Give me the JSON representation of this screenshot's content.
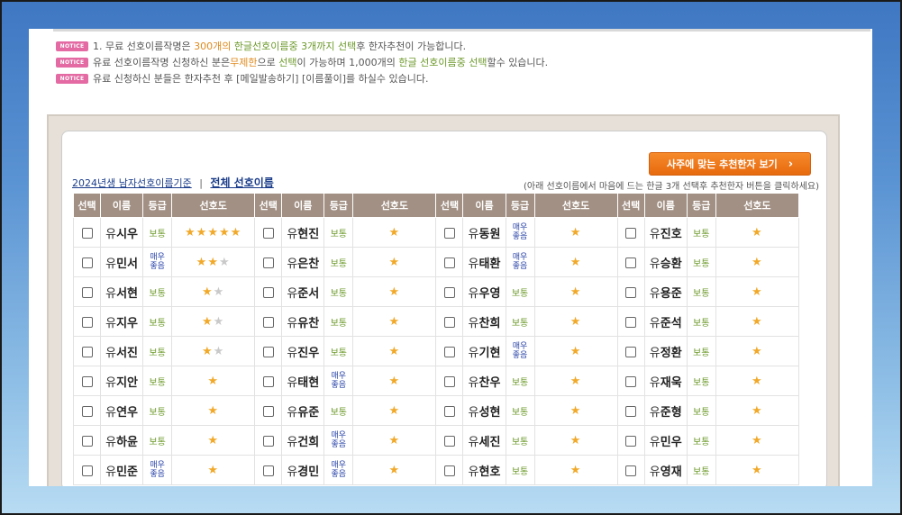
{
  "notices": [
    {
      "badge": "NOTICE",
      "parts": [
        {
          "t": "1. 무료 선호이름작명은 ",
          "c": ""
        },
        {
          "t": "300개의 ",
          "c": "orange"
        },
        {
          "t": "한글선호이름중 3개까지 ",
          "c": "green"
        },
        {
          "t": "선택",
          "c": "green"
        },
        {
          "t": "후 한자추천이 가능합니다.",
          "c": ""
        }
      ]
    },
    {
      "badge": "NOTICE",
      "parts": [
        {
          "t": "유료 선호이름작명 신청하신 분은",
          "c": ""
        },
        {
          "t": "무제한",
          "c": "orange"
        },
        {
          "t": "으로 ",
          "c": ""
        },
        {
          "t": "선택",
          "c": "green"
        },
        {
          "t": "이 가능하며 1,000개의 ",
          "c": ""
        },
        {
          "t": "한글 선호이름중 선택",
          "c": "green"
        },
        {
          "t": "할수 있습니다.",
          "c": ""
        }
      ]
    },
    {
      "badge": "NOTICE",
      "parts": [
        {
          "t": "유료 신청하신 분들은 한자추천 후 [메일발송하기] [이름풀이]를 하실수 있습니다.",
          "c": ""
        }
      ]
    }
  ],
  "links": {
    "criteria": "2024년생 남자선호이름기준",
    "separator": "|",
    "all": "전체 선호이름"
  },
  "recommend_button": "사주에 맞는 추천한자 보기",
  "hint": "(아래 선호이름에서 마음에 드는 한글 3개 선택후 추천한자 버튼을 클릭하세요)",
  "headers": [
    "선택",
    "이름",
    "등급",
    "선호도"
  ],
  "grades": {
    "normal": "보통",
    "good_line1": "매우",
    "good_line2": "좋음"
  },
  "columns": [
    [
      {
        "sur": "유",
        "given": "시우",
        "grade": "normal",
        "stars": 5
      },
      {
        "sur": "유",
        "given": "민서",
        "grade": "good",
        "stars": 2.5
      },
      {
        "sur": "유",
        "given": "서현",
        "grade": "normal",
        "stars": 1.5
      },
      {
        "sur": "유",
        "given": "지우",
        "grade": "normal",
        "stars": 1.5
      },
      {
        "sur": "유",
        "given": "서진",
        "grade": "normal",
        "stars": 1.5
      },
      {
        "sur": "유",
        "given": "지안",
        "grade": "normal",
        "stars": 1
      },
      {
        "sur": "유",
        "given": "연우",
        "grade": "normal",
        "stars": 1
      },
      {
        "sur": "유",
        "given": "하윤",
        "grade": "normal",
        "stars": 1
      },
      {
        "sur": "유",
        "given": "민준",
        "grade": "good",
        "stars": 1
      }
    ],
    [
      {
        "sur": "유",
        "given": "현진",
        "grade": "normal",
        "stars": 1
      },
      {
        "sur": "유",
        "given": "은찬",
        "grade": "normal",
        "stars": 1
      },
      {
        "sur": "유",
        "given": "준서",
        "grade": "normal",
        "stars": 1
      },
      {
        "sur": "유",
        "given": "유찬",
        "grade": "normal",
        "stars": 1
      },
      {
        "sur": "유",
        "given": "진우",
        "grade": "normal",
        "stars": 1
      },
      {
        "sur": "유",
        "given": "태현",
        "grade": "good",
        "stars": 1
      },
      {
        "sur": "유",
        "given": "유준",
        "grade": "normal",
        "stars": 1
      },
      {
        "sur": "유",
        "given": "건희",
        "grade": "good",
        "stars": 1
      },
      {
        "sur": "유",
        "given": "경민",
        "grade": "good",
        "stars": 1
      }
    ],
    [
      {
        "sur": "유",
        "given": "동원",
        "grade": "good",
        "stars": 1
      },
      {
        "sur": "유",
        "given": "태환",
        "grade": "good",
        "stars": 1
      },
      {
        "sur": "유",
        "given": "우영",
        "grade": "normal",
        "stars": 1
      },
      {
        "sur": "유",
        "given": "찬희",
        "grade": "normal",
        "stars": 1
      },
      {
        "sur": "유",
        "given": "기현",
        "grade": "good",
        "stars": 1
      },
      {
        "sur": "유",
        "given": "찬우",
        "grade": "normal",
        "stars": 1
      },
      {
        "sur": "유",
        "given": "성현",
        "grade": "normal",
        "stars": 1
      },
      {
        "sur": "유",
        "given": "세진",
        "grade": "normal",
        "stars": 1
      },
      {
        "sur": "유",
        "given": "현호",
        "grade": "normal",
        "stars": 1
      }
    ],
    [
      {
        "sur": "유",
        "given": "진호",
        "grade": "normal",
        "stars": 1
      },
      {
        "sur": "유",
        "given": "승환",
        "grade": "normal",
        "stars": 1
      },
      {
        "sur": "유",
        "given": "용준",
        "grade": "normal",
        "stars": 1
      },
      {
        "sur": "유",
        "given": "준석",
        "grade": "normal",
        "stars": 1
      },
      {
        "sur": "유",
        "given": "정환",
        "grade": "normal",
        "stars": 1
      },
      {
        "sur": "유",
        "given": "재욱",
        "grade": "normal",
        "stars": 1
      },
      {
        "sur": "유",
        "given": "준형",
        "grade": "normal",
        "stars": 1
      },
      {
        "sur": "유",
        "given": "민우",
        "grade": "normal",
        "stars": 1
      },
      {
        "sur": "유",
        "given": "영재",
        "grade": "normal",
        "stars": 1
      }
    ]
  ],
  "colors": {
    "header_bg": "#a29084",
    "button": "#ee7a1c",
    "notice_badge": "#e36aa3"
  }
}
